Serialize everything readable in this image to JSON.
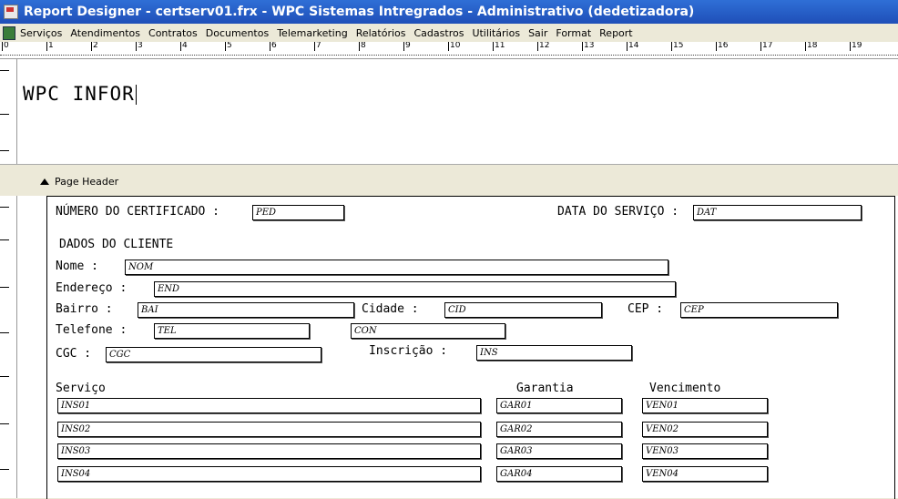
{
  "window": {
    "title": "Report Designer - certserv01.frx - WPC Sistemas Intregrados - Administrativo (dedetizadora)"
  },
  "menu": {
    "items": [
      "Serviços",
      "Atendimentos",
      "Contratos",
      "Documentos",
      "Telemarketing",
      "Relatórios",
      "Cadastros",
      "Utilitários",
      "Sair",
      "Format",
      "Report"
    ]
  },
  "ruler": {
    "ticks": [
      "0",
      "1",
      "2",
      "3",
      "4",
      "5",
      "6",
      "7",
      "8",
      "9",
      "10",
      "11",
      "12",
      "13",
      "14",
      "15",
      "16",
      "17",
      "18",
      "19"
    ]
  },
  "title_band": {
    "text": "WPC INFOR"
  },
  "band_label": "Page Header",
  "certificate": {
    "numero_label": "NÚMERO DO CERTIFICADO :",
    "numero_field": "PED",
    "data_label": "DATA DO SERVIÇO :",
    "data_field": "DAT"
  },
  "client": {
    "heading": "DADOS DO CLIENTE",
    "nome_label": "Nome :",
    "nome_field": "NOM",
    "endereco_label": "Endereço :",
    "endereco_field": "END",
    "bairro_label": "Bairro :",
    "bairro_field": "BAI",
    "cidade_label": "Cidade :",
    "cidade_field": "CID",
    "cep_label": "CEP :",
    "cep_field": "CEP",
    "telefone_label": "Telefone :",
    "telefone_field": "TEL",
    "con_field": "CON",
    "cgc_label": "CGC :",
    "cgc_field": "CGC",
    "inscricao_label": "Inscrição :",
    "inscricao_field": "INS"
  },
  "services": {
    "col_servico": "Serviço",
    "col_garantia": "Garantia",
    "col_vencimento": "Vencimento",
    "rows": [
      {
        "servico": "INS01",
        "garantia": "GAR01",
        "vencimento": "VEN01"
      },
      {
        "servico": "INS02",
        "garantia": "GAR02",
        "vencimento": "VEN02"
      },
      {
        "servico": "INS03",
        "garantia": "GAR03",
        "vencimento": "VEN03"
      },
      {
        "servico": "INS04",
        "garantia": "GAR04",
        "vencimento": "VEN04"
      }
    ]
  }
}
